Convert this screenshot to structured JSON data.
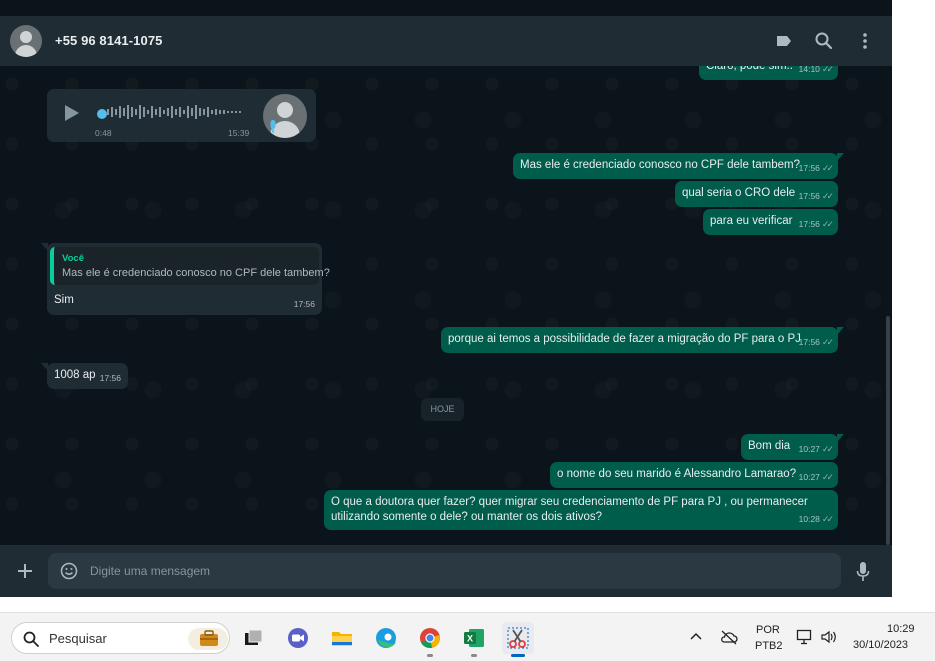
{
  "header": {
    "contact_name": "+55 96 8141-1075",
    "icons": [
      "label-icon",
      "search-icon",
      "menu-icon"
    ]
  },
  "voice_message": {
    "duration": "0:48",
    "time": "15:39"
  },
  "messages": {
    "m0": {
      "text": "Claro, pode sim..",
      "time": "14:10"
    },
    "m1": {
      "text": "Mas ele é credenciado conosco no CPF dele tambem?",
      "time": "17:56"
    },
    "m2": {
      "text": "qual seria o CRO dele",
      "time": "17:56"
    },
    "m3": {
      "text": "para eu verificar",
      "time": "17:56"
    },
    "m4": {
      "quote_author": "Você",
      "quote_text": "Mas ele é credenciado conosco no CPF dele tambem?",
      "text": "Sim",
      "time": "17:56"
    },
    "m5": {
      "text": "porque ai temos a possibilidade de fazer a migração do PF para o PJ",
      "time": "17:56"
    },
    "m6": {
      "text": "1008 ap",
      "time": "17:56"
    },
    "m7": {
      "text": "Bom dia",
      "time": "10:27"
    },
    "m8": {
      "text": "o nome do seu marido é Alessandro Lamarao?",
      "time": "10:27"
    },
    "m9": {
      "line1": "O que a doutora quer fazer? quer migrar seu credenciamento de PF para PJ , ou permanecer",
      "line2": "utilizando somente o dele? ou manter os dois ativos?",
      "time": "10:28"
    }
  },
  "date_separator": "HOJE",
  "composer": {
    "placeholder": "Digite uma mensagem"
  },
  "taskbar": {
    "search_placeholder": "Pesquisar",
    "language_top": "POR",
    "language_bottom": "PTB2",
    "time": "10:29",
    "date": "30/10/2023"
  },
  "colors": {
    "chat_background": "#0b141a",
    "header_background": "#202c33",
    "outgoing_bubble": "#005c4b",
    "incoming_bubble": "#202c33",
    "accent": "#06cf9c"
  }
}
